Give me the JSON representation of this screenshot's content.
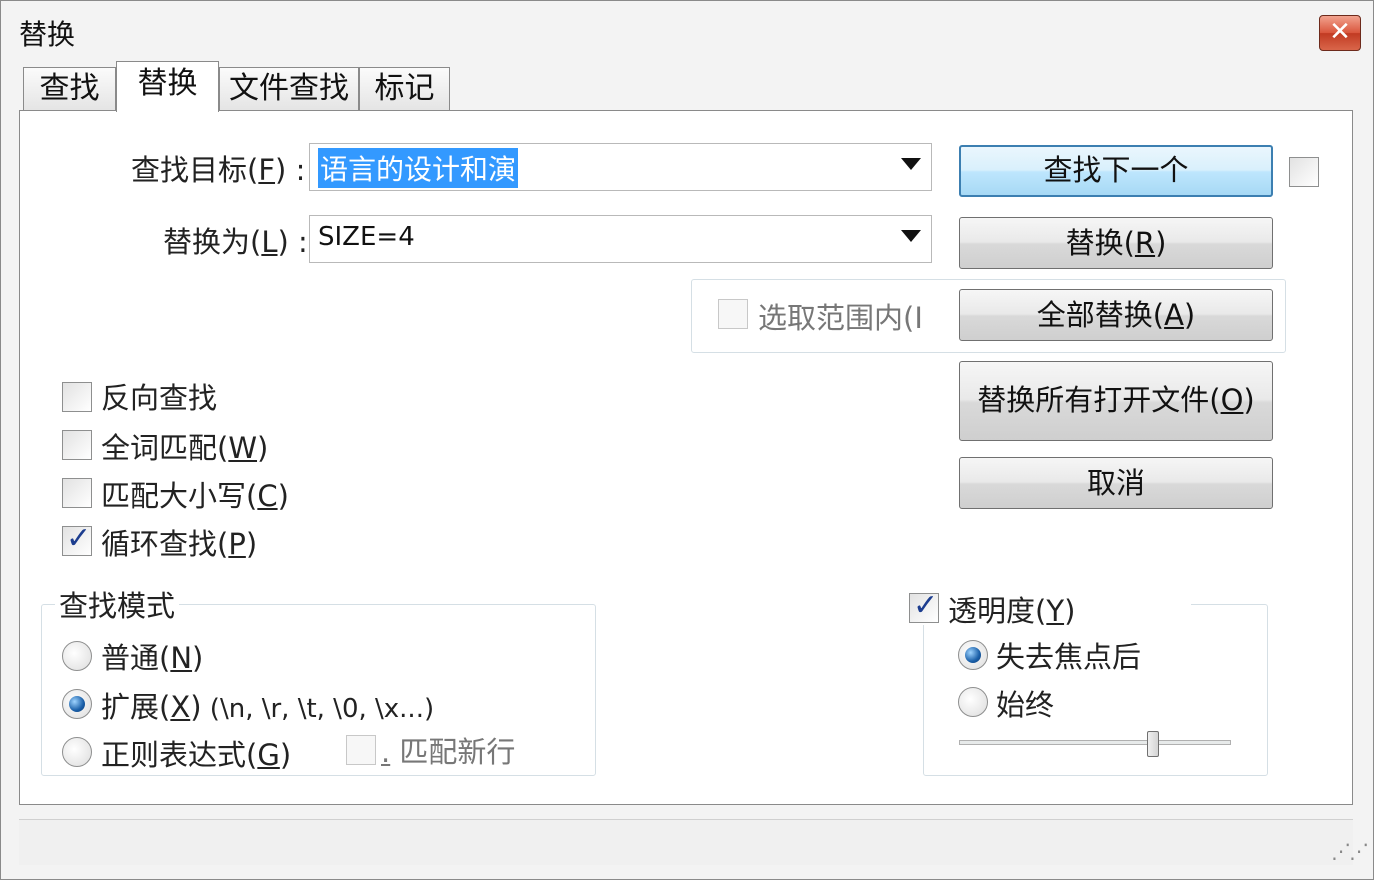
{
  "window": {
    "title": "替换",
    "close_glyph": "✕"
  },
  "tabs": [
    {
      "label": "查找"
    },
    {
      "label": "替换"
    },
    {
      "label": "文件查找"
    },
    {
      "label": "标记"
    }
  ],
  "find": {
    "label": "查找目标",
    "label_key": "F",
    "label_tail": ") :",
    "value": "语言的设计和演"
  },
  "replace": {
    "label": "替换为",
    "label_key": "L",
    "label_tail": ") :",
    "value": "SIZE=4"
  },
  "buttons": {
    "find_next": "查找下一个",
    "replace": "替换",
    "replace_key": "R",
    "replace_all": "全部替换",
    "replace_all_key": "A",
    "replace_all_open": "替换所有打开文件",
    "replace_all_open_key": "O",
    "cancel": "取消"
  },
  "in_selection": {
    "label": "选取范围内(I",
    "checked": false,
    "enabled": false
  },
  "options": {
    "backward": {
      "label": "反向查找",
      "checked": false
    },
    "whole_word": {
      "label": "全词匹配",
      "key": "W",
      "checked": false
    },
    "match_case": {
      "label": "匹配大小写",
      "key": "C",
      "checked": false
    },
    "wrap": {
      "label": "循环查找",
      "key": "P",
      "checked": true
    }
  },
  "search_mode": {
    "title": "查找模式",
    "normal": {
      "label": "普通",
      "key": "N",
      "selected": false
    },
    "extended": {
      "label": "扩展",
      "key": "X",
      "suffix": " (\\n, \\r, \\t, \\0, \\x...)",
      "selected": true
    },
    "regex": {
      "label": "正则表达式",
      "key": "G",
      "selected": false
    },
    "dot_newline": {
      "dot": ".",
      "label": " 匹配新行",
      "checked": false,
      "enabled": false
    }
  },
  "transparency": {
    "label": "透明度",
    "key": "Y",
    "checked": true,
    "on_lose_focus": {
      "label": "失去焦点后",
      "selected": true
    },
    "always": {
      "label": "始终",
      "selected": false
    },
    "level": 0.72
  },
  "grip_glyph": "⋰⋰",
  "colors": {
    "accent": "#3399ff",
    "default_button": "#bee6fd",
    "check": "#1c3d8f"
  }
}
